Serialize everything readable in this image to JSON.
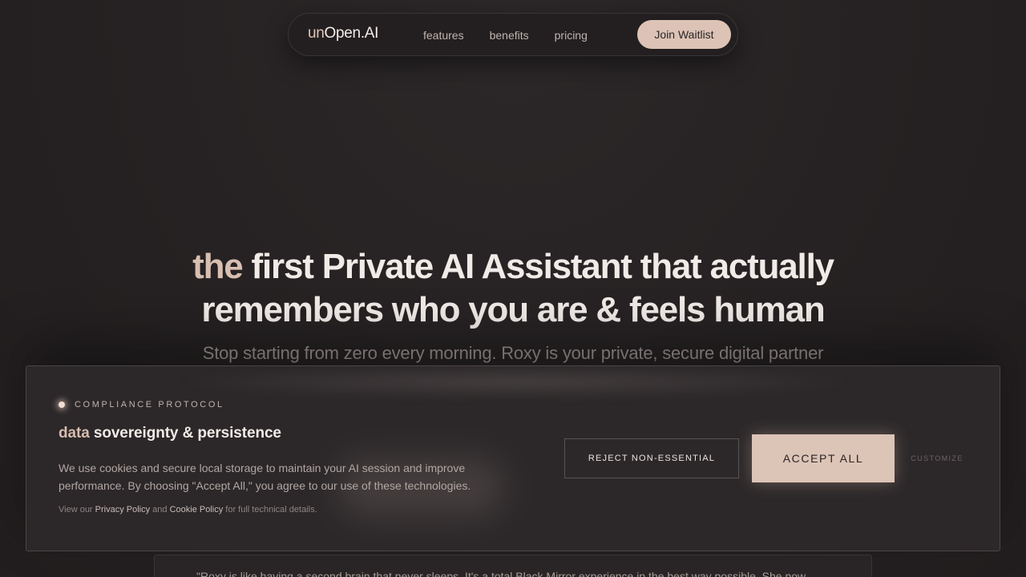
{
  "nav": {
    "logo_prefix": "un",
    "logo_main": "Open.AI",
    "links": [
      "features",
      "benefits",
      "pricing"
    ],
    "cta_label": "Join Waitlist"
  },
  "hero": {
    "title_accent": "the",
    "title_line1_rest": " first Private AI Assistant that actually",
    "title_line2": "remembers who you are & feels human",
    "subtitle": "Stop starting from zero every morning. Roxy is your private, secure digital partner"
  },
  "testimonial": {
    "text": "\"Roxy is like having a second brain that never sleeps. It's a total Black Mirror experience in the best way possible. She now"
  },
  "cookie_banner": {
    "protocol_label": "COMPLIANCE PROTOCOL",
    "title_accent": "data",
    "title_rest": " sovereignty & persistence",
    "body": "We use cookies and secure local storage to maintain your AI session and improve performance. By choosing \"Accept All,\" you agree to our use of these technologies.",
    "legal_prefix": "View our ",
    "privacy_link": "Privacy Policy",
    "legal_and": " and ",
    "cookie_link": "Cookie Policy",
    "legal_suffix": " for full technical details.",
    "reject_label": "REJECT NON-ESSENTIAL",
    "accept_label": "ACCEPT ALL",
    "customize_label": "CUSTOMIZE"
  },
  "colors": {
    "background": "#262223",
    "accent": "#dcc3b6",
    "text": "#f1ebe8"
  }
}
